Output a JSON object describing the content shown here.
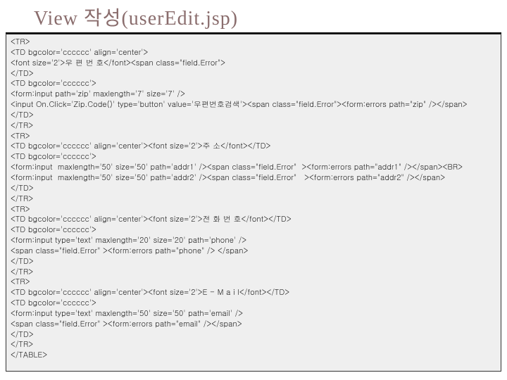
{
  "title": "View 작성(userEdit.jsp)",
  "code": {
    "lines": [
      "<TR>",
      "<TD bgcolor='cccccc' align='center'>",
      "<font size='2'>우 편 번 호</font><span class=\"field.Error\">",
      "</TD>",
      "<TD bgcolor='cccccc'>",
      "<form:input path='zip' maxlength='7' size='7' />",
      "<input On.Click='Zip.Code()' type='button' value='우편번호검색'><span class=\"field.Error\"><form:errors path=\"zip\" /></span>",
      "</TD>",
      "</TR>",
      "<TR>",
      "<TD bgcolor='cccccc' align='center'><font size='2'>주 소</font></TD>",
      "<TD bgcolor='cccccc'>",
      "<form:input  maxlength='50' size='50' path='addr1' /><span class=\"field.Error\"  ><form:errors path=\"addr1\" /></span><BR>",
      "<form:input  maxlength='50' size='50' path='addr2' /><span class=\"field.Error\"   ><form:errors path=\"addr2\" /></span>",
      "</TD>",
      "</TR>",
      "<TR>",
      "<TD bgcolor='cccccc' align='center'><font size='2'>전 화 번 호</font></TD>",
      "<TD bgcolor='cccccc'>",
      "<form:input type='text' maxlength='20' size='20' path='phone' />",
      "<span class=\"field.Error\" ><form:errors path=\"phone\" /> </span>",
      "</TD>",
      "</TR>",
      "<TR>",
      "<TD bgcolor='cccccc' align='center'><font size='2'>E - M a i l</font></TD>",
      "<TD bgcolor='cccccc'>",
      "<form:input type='text' maxlength='50' size='50' path='email' />",
      "<span class=\"field.Error\" ><form:errors path=\"email\" /></span>",
      "</TD>",
      "</TR>",
      "</TABLE>"
    ]
  }
}
